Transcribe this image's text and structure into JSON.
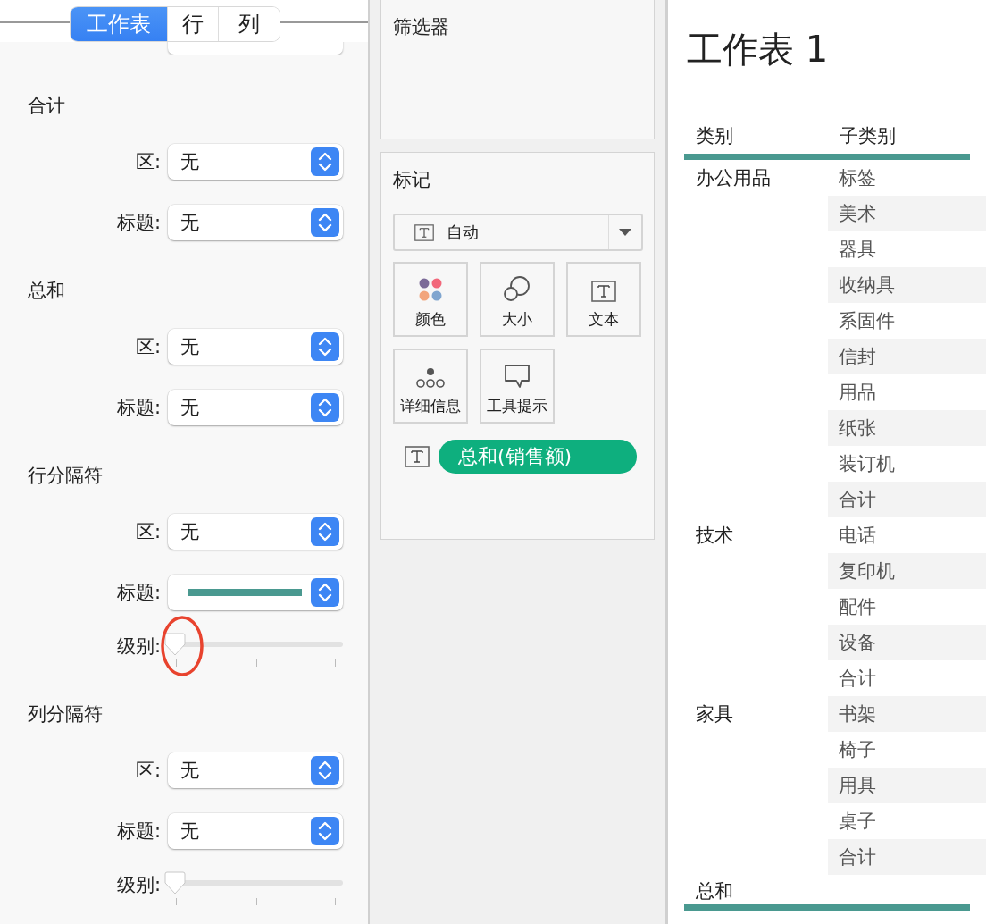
{
  "tabs": [
    {
      "label": "工作表",
      "selected": true
    },
    {
      "label": "行",
      "selected": false
    },
    {
      "label": "列",
      "selected": false
    }
  ],
  "format_sections": [
    {
      "title": "合计",
      "rows": [
        {
          "kind": "dropdown",
          "label": "区:",
          "value": "无"
        },
        {
          "kind": "dropdown",
          "label": "标题:",
          "value": "无"
        }
      ]
    },
    {
      "title": "总和",
      "rows": [
        {
          "kind": "dropdown",
          "label": "区:",
          "value": "无"
        },
        {
          "kind": "dropdown",
          "label": "标题:",
          "value": "无"
        }
      ]
    },
    {
      "title": "行分隔符",
      "rows": [
        {
          "kind": "dropdown",
          "label": "区:",
          "value": "无"
        },
        {
          "kind": "line",
          "label": "标题:"
        },
        {
          "kind": "slider",
          "label": "级别:",
          "level": 0,
          "highlighted": true
        }
      ]
    },
    {
      "title": "列分隔符",
      "rows": [
        {
          "kind": "dropdown",
          "label": "区:",
          "value": "无"
        },
        {
          "kind": "dropdown",
          "label": "标题:",
          "value": "无"
        },
        {
          "kind": "slider",
          "label": "级别:",
          "level": 0,
          "highlighted": false
        }
      ]
    }
  ],
  "filters": {
    "title": "筛选器"
  },
  "marks": {
    "title": "标记",
    "mark_type": "自动",
    "buttons": [
      {
        "kind": "color",
        "label": "颜色"
      },
      {
        "kind": "size",
        "label": "大小"
      },
      {
        "kind": "text",
        "label": "文本"
      },
      {
        "kind": "detail",
        "label": "详细信息"
      },
      {
        "kind": "tooltip",
        "label": "工具提示"
      }
    ],
    "fields": [
      {
        "label": "总和(销售额)"
      }
    ]
  },
  "sheet": {
    "title": "工作表 1",
    "columns": [
      "类别",
      "子类别"
    ],
    "groups": [
      {
        "category": "办公用品",
        "items": [
          "标签",
          "美术",
          "器具",
          "收纳具",
          "系固件",
          "信封",
          "用品",
          "纸张",
          "装订机",
          "合计"
        ]
      },
      {
        "category": "技术",
        "items": [
          "电话",
          "复印机",
          "配件",
          "设备",
          "合计"
        ]
      },
      {
        "category": "家具",
        "items": [
          "书架",
          "椅子",
          "用具",
          "桌子",
          "合计"
        ]
      }
    ],
    "grand_total": "总和"
  }
}
